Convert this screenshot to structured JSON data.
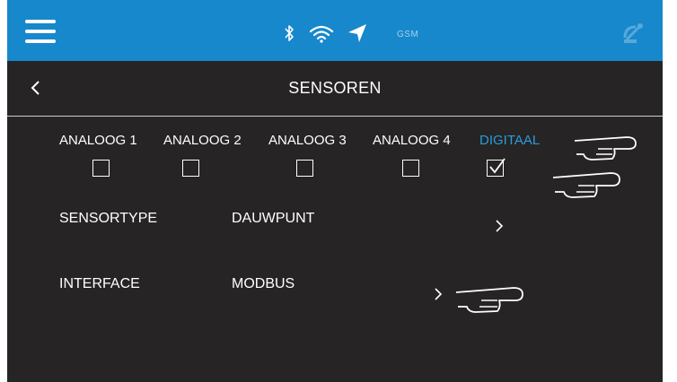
{
  "topbar": {
    "menu_icon": "hamburger-menu-icon",
    "status_icons": [
      "bluetooth-icon",
      "wifi-icon",
      "location-arrow-icon"
    ],
    "gsm_label": "GSM",
    "right_icon": "satellite-dish-icon"
  },
  "header": {
    "back_icon": "chevron-left-icon",
    "title": "SENSOREN"
  },
  "tabs": [
    {
      "label": "ANALOOG 1",
      "checked": false
    },
    {
      "label": "ANALOOG 2",
      "checked": false
    },
    {
      "label": "ANALOOG 3",
      "checked": false
    },
    {
      "label": "ANALOOG 4",
      "checked": false
    },
    {
      "label": "DIGITAAL",
      "checked": true,
      "active": true
    }
  ],
  "rows": [
    {
      "label": "SENSORTYPE",
      "value": "DAUWPUNT",
      "chevron_icon": "chevron-right-icon"
    },
    {
      "label": "INTERFACE",
      "value": "MODBUS",
      "chevron_icon": "chevron-right-icon"
    }
  ],
  "annotations": {
    "pointer_icon": "pointing-hand-icon"
  },
  "colors": {
    "topbar": "#1888cc",
    "background": "#262424",
    "active_tab": "#2a9ddc"
  }
}
